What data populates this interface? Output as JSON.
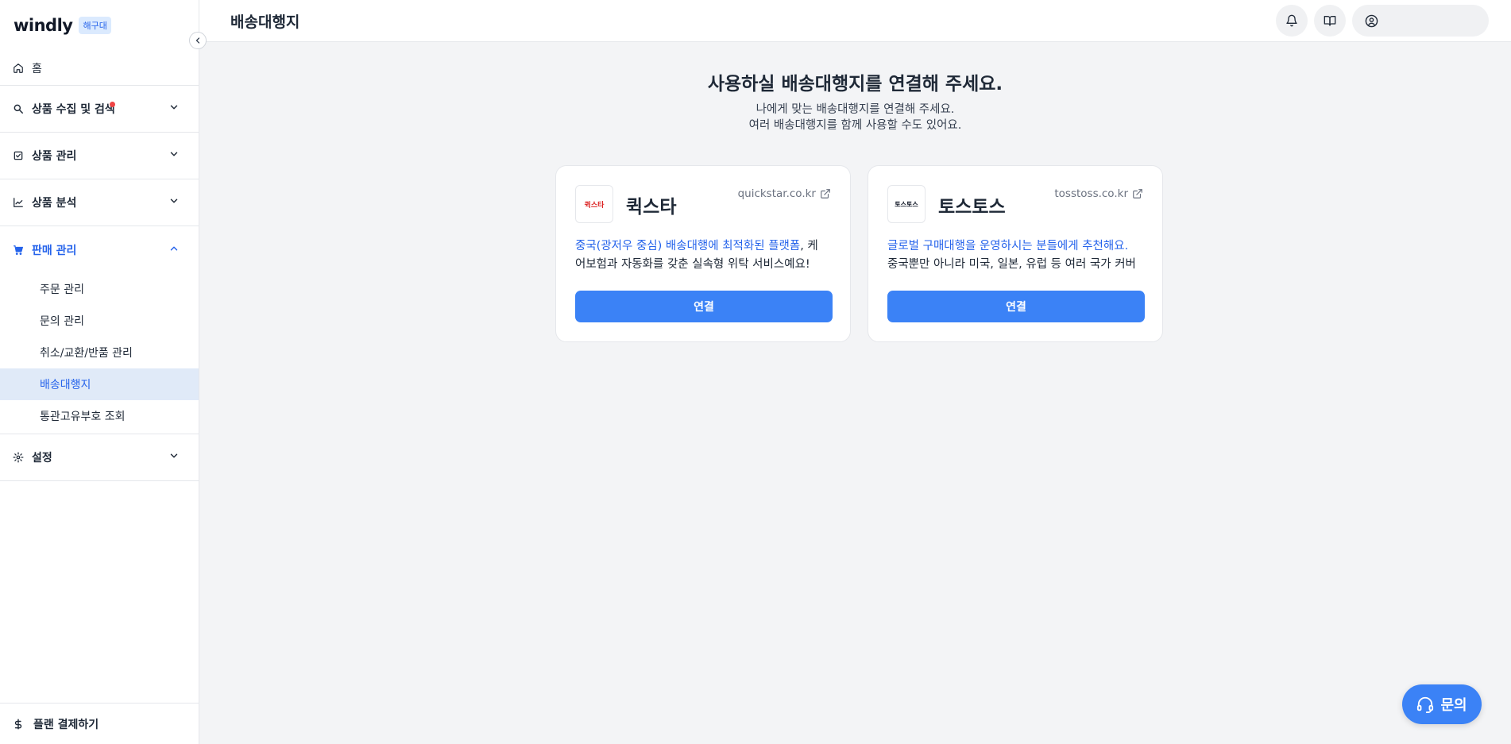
{
  "sidebar": {
    "logo": "windly",
    "badge": "해구대",
    "home": "홈",
    "sections": [
      {
        "label": "상품 수집 및 검색",
        "icon": "search-icon"
      },
      {
        "label": "상품 관리",
        "icon": "clipboard-check-icon"
      },
      {
        "label": "상품 분석",
        "icon": "chart-line-icon"
      },
      {
        "label": "판매 관리",
        "icon": "cart-icon"
      },
      {
        "label": "설정",
        "icon": "gear-icon"
      }
    ],
    "sales_items": [
      "주문 관리",
      "문의 관리",
      "취소/교환/반품 관리",
      "배송대행지",
      "통관고유부호 조회"
    ],
    "plan": "플랜 결제하기"
  },
  "header": {
    "title": "배송대행지"
  },
  "main": {
    "title": "사용하실 배송대행지를 연결해 주세요.",
    "subtitle_1": "나에게 맞는 배송대행지를 연결해 주세요.",
    "subtitle_2": "여러 배송대행지를 함께 사용할 수도 있어요.",
    "cards": [
      {
        "logo_text": "퀵스타",
        "name": "퀵스타",
        "link": "quickstar.co.kr",
        "desc_highlight": "중국(광저우 중심) 배송대행에 최적화된 플랫폼",
        "desc_rest_1": ", 케",
        "desc_line_2": "어보험과 자동화를 갖춘 실속형 위탁 서비스예요!",
        "button": "연결"
      },
      {
        "logo_text": "토스토스",
        "name": "토스토스",
        "link": "tosstoss.co.kr",
        "desc_highlight": "글로벌 구매대행을 운영하시는 분들에게 추천해요.",
        "desc_rest_1": "",
        "desc_line_2": "중국뿐만 아니라 미국, 일본, 유럽 등 여러 국가 커버",
        "button": "연결"
      }
    ]
  },
  "fab": {
    "label": "문의"
  },
  "colors": {
    "accent": "#3b82f6",
    "active_text": "#2563eb",
    "selected_bg": "#e0eaf8",
    "badge_dot": "#ef4444"
  }
}
